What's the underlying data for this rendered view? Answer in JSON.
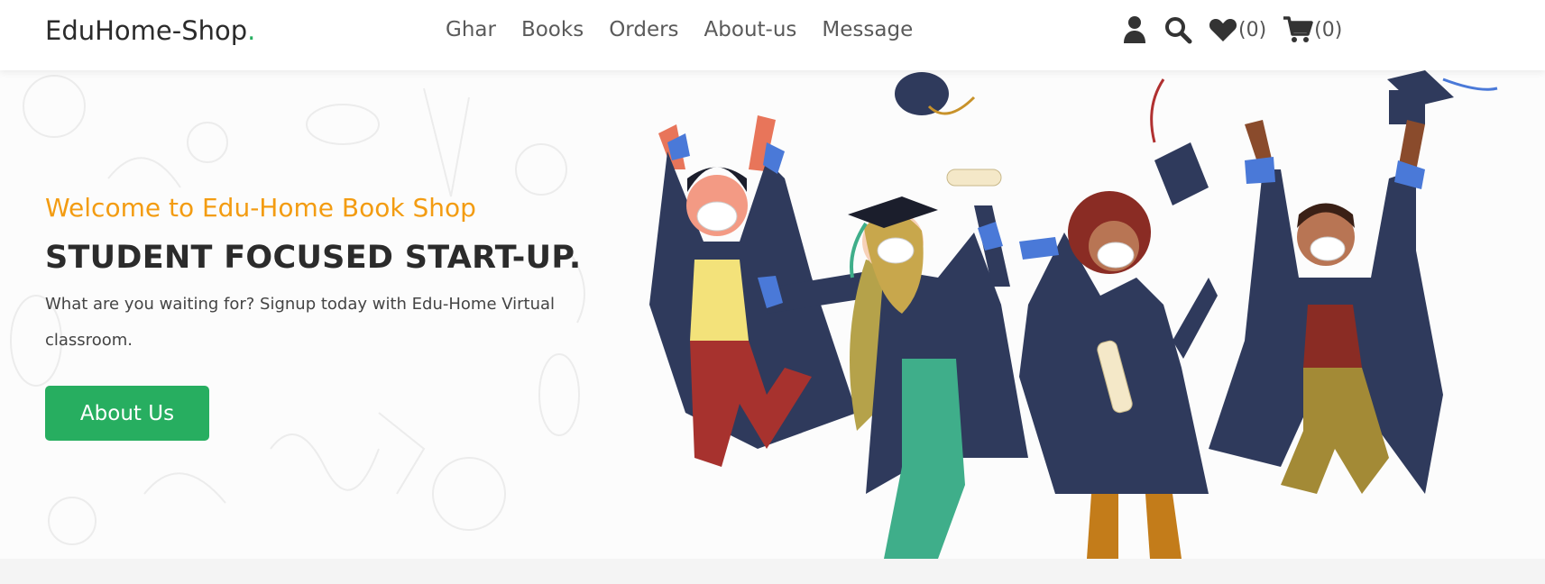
{
  "header": {
    "logo_text": "EduHome-Shop",
    "logo_dot": ".",
    "nav": [
      "Ghar",
      "Books",
      "Orders",
      "About-us",
      "Message"
    ],
    "wishlist_count": "(0)",
    "cart_count": "(0)"
  },
  "hero": {
    "welcome": "Welcome to Edu-Home Book Shop",
    "headline": "STUDENT FOCUSED START-UP.",
    "description": "What are you waiting for? Signup today with Edu-Home Virtual classroom.",
    "button_label": "About Us"
  },
  "icons": [
    "user-icon",
    "search-icon",
    "heart-icon",
    "cart-icon"
  ],
  "colors": {
    "accent": "#f39c12",
    "brand": "#27ae60",
    "gown": "#2f3a5c",
    "gown_trim": "#4a79d8"
  }
}
